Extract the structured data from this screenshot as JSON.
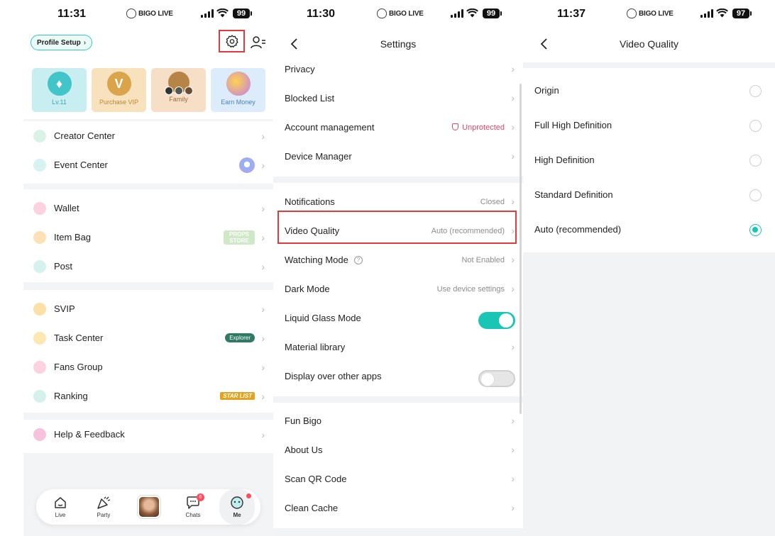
{
  "colors": {
    "accent": "#19c6b6",
    "highlight": "#e03a3a",
    "warning": "#e8456a"
  },
  "panel1": {
    "status": {
      "time": "11:31",
      "brand": "BIGO LIVE",
      "battery": "99"
    },
    "profile_setup": "Profile Setup",
    "tiles": [
      {
        "label": "Lv.11",
        "glyph": "♦"
      },
      {
        "label": "Purchase VIP",
        "glyph": "V"
      },
      {
        "label": "Family",
        "glyph": ""
      },
      {
        "label": "Earn Money",
        "glyph": ""
      }
    ],
    "menu": [
      {
        "label": "Creator Center"
      },
      {
        "label": "Event Center"
      },
      {
        "label": "Wallet"
      },
      {
        "label": "Item Bag",
        "extra": "PROPS STORE"
      },
      {
        "label": "Post"
      },
      {
        "label": "SVIP"
      },
      {
        "label": "Task Center",
        "extra": "Explorer"
      },
      {
        "label": "Fans Group"
      },
      {
        "label": "Ranking",
        "extra": "STAR LIST"
      },
      {
        "label": "Help & Feedback"
      }
    ],
    "nav": [
      {
        "label": "Live"
      },
      {
        "label": "Party"
      },
      {
        "label": ""
      },
      {
        "label": "Chats",
        "badge": "6"
      },
      {
        "label": "Me"
      }
    ]
  },
  "panel2": {
    "status": {
      "time": "11:30",
      "brand": "BIGO LIVE",
      "battery": "99"
    },
    "title": "Settings",
    "rows": [
      {
        "label": "Privacy",
        "value": ""
      },
      {
        "label": "Blocked List",
        "value": ""
      },
      {
        "label": "Account management",
        "value": "Unprotected"
      },
      {
        "label": "Device Manager",
        "value": ""
      },
      {
        "label": "Notifications",
        "value": "Closed"
      },
      {
        "label": "Video Quality",
        "value": "Auto (recommended)"
      },
      {
        "label": "Watching Mode",
        "value": "Not Enabled"
      },
      {
        "label": "Dark Mode",
        "value": "Use device settings"
      },
      {
        "label": "Liquid Glass Mode",
        "value": ""
      },
      {
        "label": "Material library",
        "value": ""
      },
      {
        "label": "Display over other apps",
        "value": ""
      },
      {
        "label": "Fun Bigo",
        "value": ""
      },
      {
        "label": "About Us",
        "value": ""
      },
      {
        "label": "Scan QR Code",
        "value": ""
      },
      {
        "label": "Clean Cache",
        "value": ""
      }
    ]
  },
  "panel3": {
    "status": {
      "time": "11:37",
      "brand": "BIGO LIVE",
      "battery": "97"
    },
    "title": "Video Quality",
    "options": [
      {
        "label": "Origin"
      },
      {
        "label": "Full High Definition"
      },
      {
        "label": "High Definition"
      },
      {
        "label": "Standard Definition"
      },
      {
        "label": "Auto (recommended)"
      }
    ],
    "selected_option": "Auto (recommended)"
  }
}
